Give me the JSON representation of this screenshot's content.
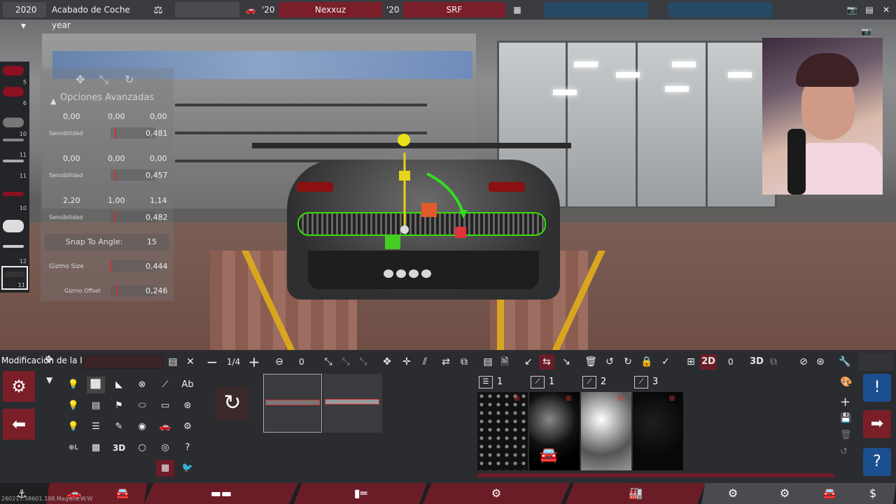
{
  "topbar": {
    "year": "2020",
    "title": "Acabado de Coche year",
    "year_left": "'20",
    "player": "Nexxuz",
    "year_right": "'20",
    "team": "SRF"
  },
  "thumbs": [
    {
      "num": "5"
    },
    {
      "num": "6"
    },
    {
      "num": "10"
    },
    {
      "num": "11"
    },
    {
      "num": "11"
    },
    {
      "num": "10"
    },
    {
      "num": ""
    },
    {
      "num": "12"
    },
    {
      "num": "11"
    }
  ],
  "gizmo": {
    "title": "Opciones Avanzadas",
    "position": [
      "0,00",
      "0,00",
      "0,00"
    ],
    "position_sens": "0,481",
    "rotation": [
      "0,00",
      "0,00",
      "0,00"
    ],
    "rotation_sens": "0,457",
    "scale": [
      "2,20",
      "1,00",
      "1,14"
    ],
    "scale_sens": "0,482",
    "sensitivity_label": "Sensibilidad",
    "snap_label": "Snap To Angle:",
    "snap_value": "15",
    "gizmo_size_label": "Gizmo Size",
    "gizmo_size": "0,444",
    "gizmo_offset_label": "Gizmo Offset",
    "gizmo_offset": "0,246"
  },
  "toolbar": {
    "mod_label": "Modificación de la IA",
    "page": "1/4",
    "value_a": "0",
    "value_b": "0",
    "mode_2d": "2D",
    "mode_3d": "3D"
  },
  "shapes": {
    "text_tool": "Ab",
    "three_d": "3D"
  },
  "materials": [
    {
      "count": "1"
    },
    {
      "count": "1"
    },
    {
      "count": "2"
    },
    {
      "count": "3"
    }
  ],
  "footer": {
    "version": "260217.58601.198.Magulla.W.W"
  },
  "colors": {
    "accent_red": "#7a1e28",
    "selection_green": "#33e000",
    "info_blue": "#1b4f8f"
  }
}
